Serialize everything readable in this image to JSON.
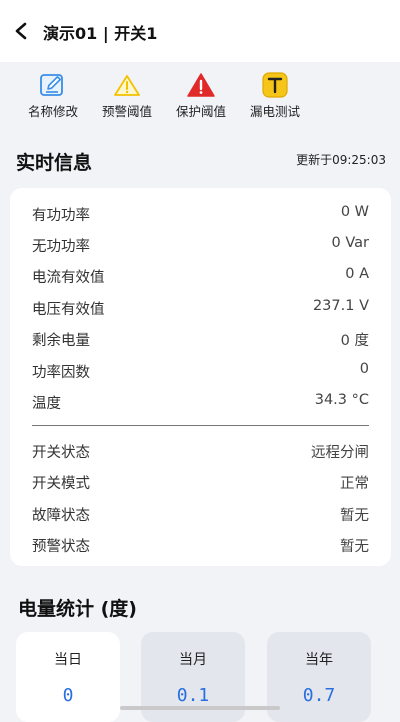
{
  "header": {
    "title": "演示01 | 开关1"
  },
  "actions": [
    {
      "label": "名称修改",
      "icon": "edit-icon"
    },
    {
      "label": "预警阈值",
      "icon": "warning-outline-icon"
    },
    {
      "label": "保护阈值",
      "icon": "warning-filled-icon"
    },
    {
      "label": "漏电测试",
      "icon": "test-t-icon"
    }
  ],
  "realtime": {
    "title": "实时信息",
    "updated": "更新于09:25:03",
    "metrics": [
      {
        "label": "有功功率",
        "value": "0 W"
      },
      {
        "label": "无功功率",
        "value": "0 Var"
      },
      {
        "label": "电流有效值",
        "value": "0 A"
      },
      {
        "label": "电压有效值",
        "value": "237.1 V"
      },
      {
        "label": "剩余电量",
        "value": "0 度"
      },
      {
        "label": "功率因数",
        "value": "0"
      },
      {
        "label": "温度",
        "value": "34.3 °C"
      }
    ],
    "states": [
      {
        "label": "开关状态",
        "value": "远程分闸"
      },
      {
        "label": "开关模式",
        "value": "正常"
      },
      {
        "label": "故障状态",
        "value": "暂无"
      },
      {
        "label": "预警状态",
        "value": "暂无"
      }
    ]
  },
  "energy": {
    "title": "电量统计 (度)",
    "tabs": [
      {
        "label": "当日",
        "value": "0"
      },
      {
        "label": "当月",
        "value": "0.1"
      },
      {
        "label": "当年",
        "value": "0.7"
      }
    ]
  },
  "colors": {
    "accent": "#2a6fe0",
    "warning": "#f5c518",
    "danger": "#e02a2a",
    "edit": "#3a8ee6"
  }
}
